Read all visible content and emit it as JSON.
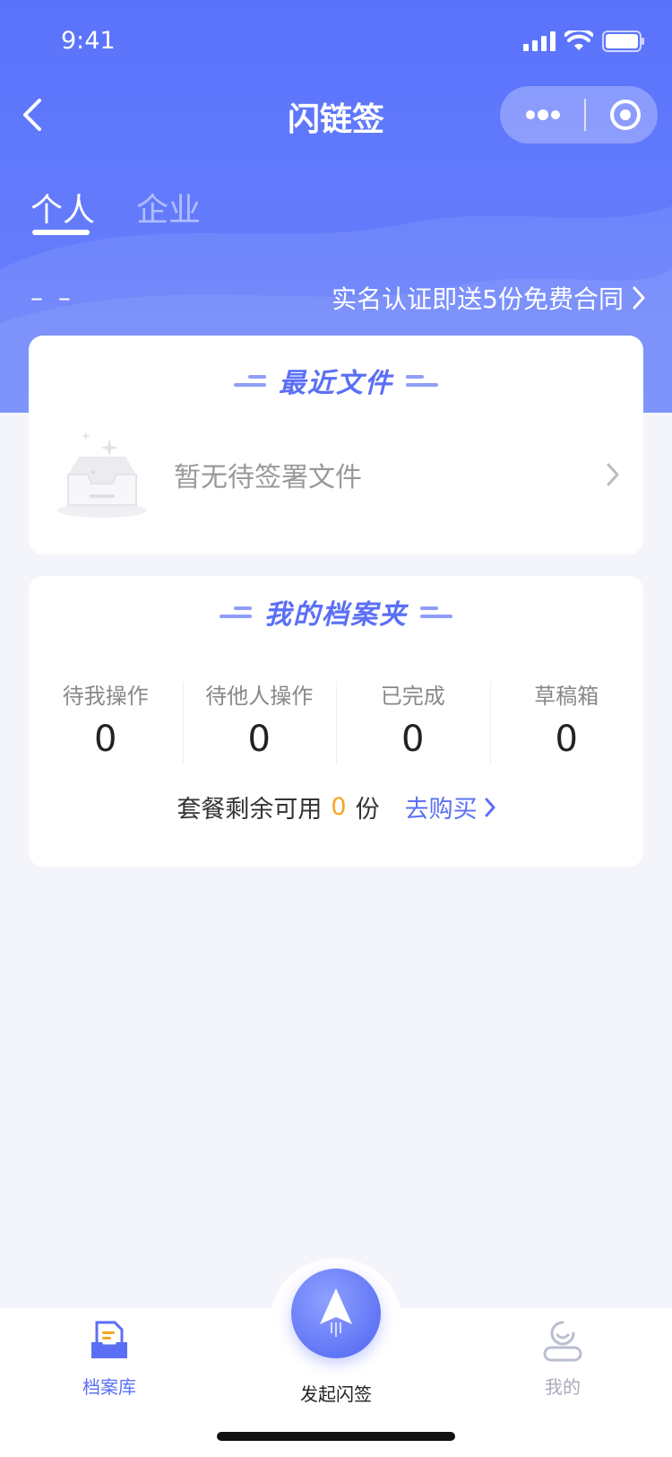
{
  "status_bar": {
    "time": "9:41"
  },
  "nav": {
    "title": "闪链签"
  },
  "tabs": {
    "personal": "个人",
    "enterprise": "企业"
  },
  "user": {
    "name": "– –"
  },
  "promo": {
    "text": "实名认证即送5份免费合同"
  },
  "recent": {
    "title": "最近文件",
    "empty_text": "暂无待签署文件"
  },
  "folder": {
    "title": "我的档案夹",
    "stats": [
      {
        "label": "待我操作",
        "value": "0"
      },
      {
        "label": "待他人操作",
        "value": "0"
      },
      {
        "label": "已完成",
        "value": "0"
      },
      {
        "label": "草稿箱",
        "value": "0"
      }
    ],
    "quota_prefix": "套餐剩余可用",
    "quota_value": "0",
    "quota_unit": "份",
    "buy_label": "去购买"
  },
  "tabbar": {
    "archive": "档案库",
    "start": "发起闪签",
    "mine": "我的"
  },
  "colors": {
    "primary": "#5b6ff6",
    "quota": "#f5a623"
  }
}
